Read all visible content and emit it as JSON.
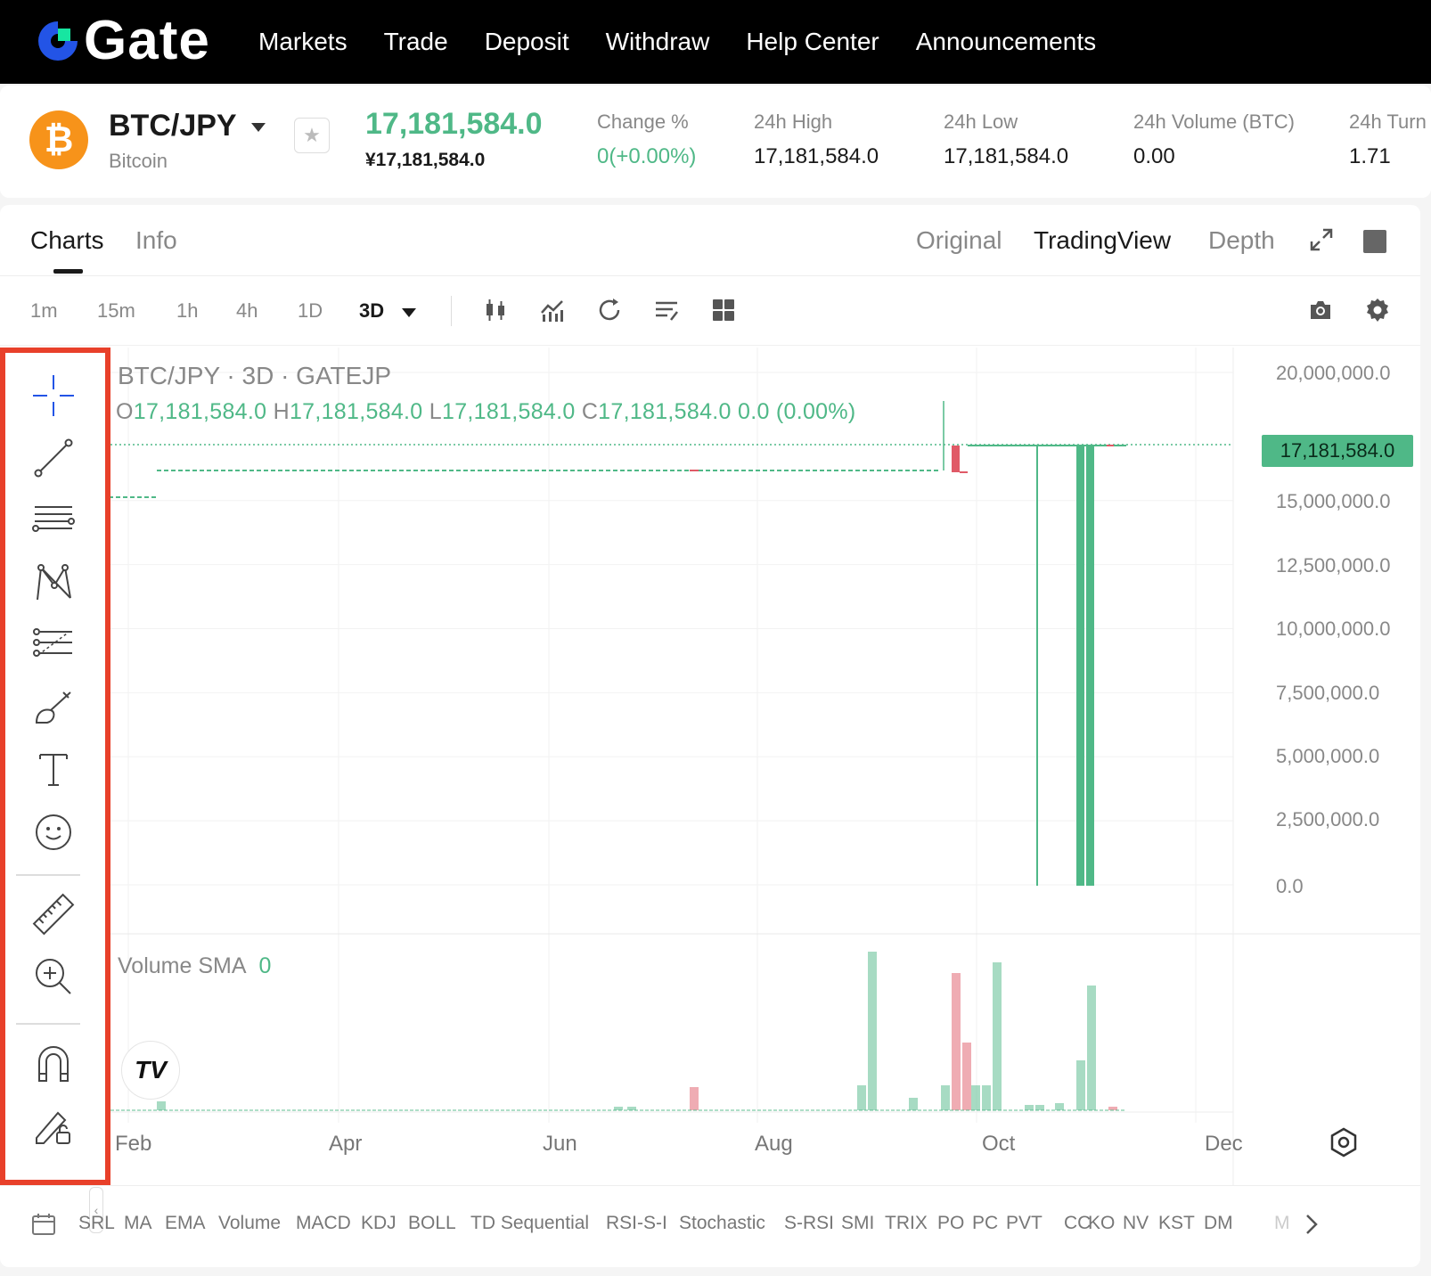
{
  "brand": {
    "name": "Gate",
    "accent": "#2354e6",
    "accent2": "#17e6a1"
  },
  "nav": {
    "items": [
      {
        "label": "Markets"
      },
      {
        "label": "Trade"
      },
      {
        "label": "Deposit"
      },
      {
        "label": "Withdraw"
      },
      {
        "label": "Help Center"
      },
      {
        "label": "Announcements"
      }
    ]
  },
  "ticker": {
    "pair": "BTC/JPY",
    "coin_name": "Bitcoin",
    "coin_symbol": "₿",
    "last_price": "17,181,584.0",
    "jpy_price": "¥17,181,584.0",
    "stats": [
      {
        "label": "Change %",
        "value": "0(+0.00%)",
        "green": true
      },
      {
        "label": "24h High",
        "value": "17,181,584.0"
      },
      {
        "label": "24h Low",
        "value": "17,181,584.0"
      },
      {
        "label": "24h Volume (BTC)",
        "value": "0.00"
      },
      {
        "label": "24h Turn",
        "value": "1.71"
      }
    ],
    "up_color": "#4fb887",
    "down_color": "#e05a67"
  },
  "tabs": {
    "charts": "Charts",
    "info": "Info"
  },
  "views": {
    "original": "Original",
    "tradingview": "TradingView",
    "depth": "Depth"
  },
  "timeframes": [
    "1m",
    "15m",
    "1h",
    "4h",
    "1D",
    "3D"
  ],
  "selected_timeframe": "3D",
  "legend": {
    "title": "BTC/JPY · 3D · GATEJP",
    "o_key": "O",
    "o": "17,181,584.0",
    "h_key": "H",
    "h": "17,181,584.0",
    "l_key": "L",
    "l": "17,181,584.0",
    "c_key": "C",
    "c": "17,181,584.0",
    "change": "0.0 (0.00%)"
  },
  "volume_legend": {
    "label": "Volume SMA",
    "value": "0"
  },
  "tv_logo": "TV",
  "current_price_tag": "17,181,584.0",
  "chart_data": {
    "type": "candlestick",
    "y_ticks": [
      "20,000,000.0",
      "15,000,000.0",
      "12,500,000.0",
      "10,000,000.0",
      "7,500,000.0",
      "5,000,000.0",
      "2,500,000.0",
      "0.0"
    ],
    "x_ticks": [
      "Feb",
      "Apr",
      "Jun",
      "Aug",
      "Oct",
      "Dec"
    ],
    "ylim": [
      0,
      20000000
    ],
    "current_price": 17181584.0,
    "grid": true
  },
  "indicators": [
    "SRL",
    "MA",
    "EMA",
    "Volume",
    "MACD",
    "KDJ",
    "BOLL",
    "TD Sequential",
    "RSI-S-I",
    "Stochastic",
    "S-RSI",
    "SMI",
    "TRIX",
    "PO",
    "PC",
    "PVT",
    "CC",
    "KO",
    "NV",
    "KST",
    "DM",
    "M"
  ]
}
